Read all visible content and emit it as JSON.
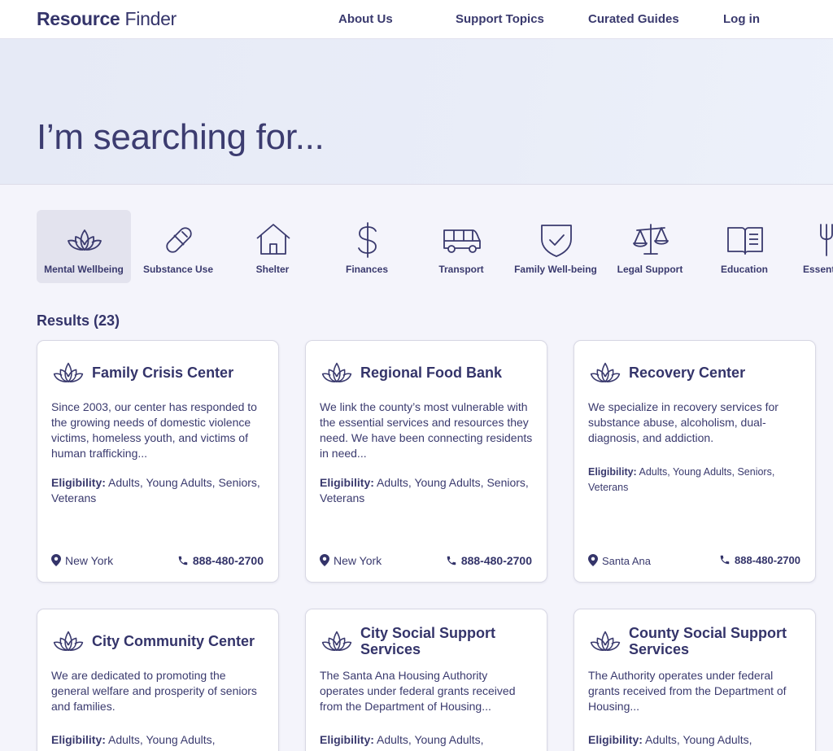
{
  "brand": {
    "part1": "Resource",
    "part2": " Finder"
  },
  "nav": [
    {
      "label": "About Us"
    },
    {
      "label": "Support Topics"
    },
    {
      "label": "Curated Guides"
    },
    {
      "label": "Log in"
    }
  ],
  "hero": {
    "heading": "I’m searching for..."
  },
  "categories": [
    {
      "label": "Mental Wellbeing",
      "icon": "lotus-icon",
      "active": true
    },
    {
      "label": "Substance Use",
      "icon": "pill-icon"
    },
    {
      "label": "Shelter",
      "icon": "house-icon"
    },
    {
      "label": "Finances",
      "icon": "dollar-icon"
    },
    {
      "label": "Transport",
      "icon": "van-icon"
    },
    {
      "label": "Family Well-being",
      "icon": "shield-check-icon"
    },
    {
      "label": "Legal Support",
      "icon": "scales-icon"
    },
    {
      "label": "Education",
      "icon": "book-icon"
    },
    {
      "label": "Essentials",
      "icon": "fork-icon"
    }
  ],
  "results": {
    "label": "Results (23)"
  },
  "cards": [
    {
      "title": "Family Crisis Center",
      "description": "Since 2003, our center has responded to the growing needs of domestic violence victims, homeless youth, and victims of human trafficking...",
      "eligibility_label": "Eligibility:",
      "eligibility": " Adults, Young Adults, Seniors, Veterans",
      "location": "New York",
      "phone": "888-480-2700"
    },
    {
      "title": "Regional Food Bank",
      "description": "We link the county’s most vulnerable with the essential services and resources they need. We have been connecting residents in need...",
      "eligibility_label": "Eligibility:",
      "eligibility": " Adults, Young Adults, Seniors, Veterans",
      "location": "New York",
      "phone": "888-480-2700"
    },
    {
      "title": "Recovery Center",
      "description": "We specialize in recovery services for substance abuse, alcoholism, dual-diagnosis, and addiction.",
      "eligibility_label": "Eligibility:",
      "eligibility": " Adults, Young Adults, Seniors, Veterans",
      "location": "Santa Ana",
      "phone": "888-480-2700"
    },
    {
      "title": "City Community Center",
      "description": "We are dedicated to promoting the general welfare and prosperity of seniors and families.",
      "eligibility_label": "Eligibility:",
      "eligibility": " Adults, Young Adults,"
    },
    {
      "title": "City Social Support Services",
      "description": "The Santa Ana Housing Authority operates under federal grants received from the Department of Housing...",
      "eligibility_label": "Eligibility:",
      "eligibility": " Adults, Young Adults,"
    },
    {
      "title": "County Social Support Services",
      "description": "The Authority operates under federal grants received from the Department of Housing...",
      "eligibility_label": "Eligibility:",
      "eligibility": " Adults, Young Adults,"
    }
  ],
  "colors": {
    "primary": "#34346a",
    "active_tab": "#e3e3ee",
    "hero": "#e6eaf6",
    "background": "#f4f4fb"
  }
}
